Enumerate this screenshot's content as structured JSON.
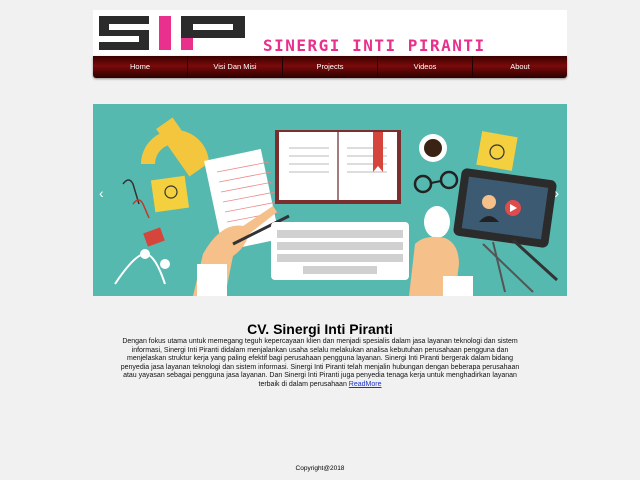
{
  "brand": {
    "name": "SINERGI INTI PIRANTI",
    "logo_text": "SIP"
  },
  "nav": {
    "items": [
      "Home",
      "Visi Dan Misi",
      "Projects",
      "Videos",
      "About"
    ]
  },
  "slider": {
    "prev_icon": "‹",
    "next_icon": "›"
  },
  "main": {
    "title": "CV. Sinergi Inti Piranti",
    "description": "Dengan fokus utama untuk memegang teguh kepercayaan klien dan menjadi spesialis dalam jasa layanan teknologi dan sistem informasi, Sinergi Inti Piranti didalam menjalankan usaha selalu melakukan analisa kebutuhan perusahaan pengguna dan menjelaskan struktur kerja yang paling efektif bagi perusahaan pengguna layanan. Sinergi Inti Piranti bergerak dalam bidang penyedia jasa layanan teknologi dan sistem informasi. Sinergi Inti Piranti telah menjalin hubungan dengan beberapa perusahaan atau yayasan sebagai pengguna jasa layanan. Dan Sinergi Inti Piranti juga penyedia tenaga kerja untuk menghadirkan layanan terbaik di dalam perusahaan",
    "readmore": "ReadMore"
  },
  "footer": {
    "copyright": "Copyright@2018"
  },
  "colors": {
    "accent": "#e8308c",
    "nav": "#7a0a0a",
    "slider_bg": "#55b9b0"
  }
}
